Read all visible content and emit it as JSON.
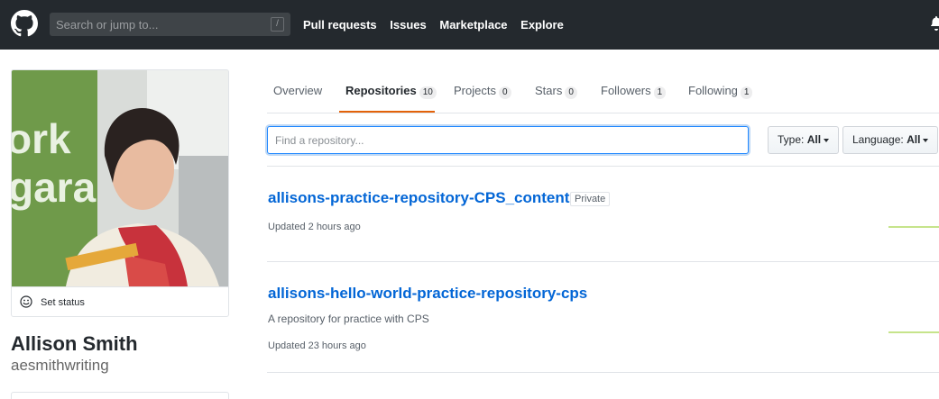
{
  "header": {
    "search_placeholder": "Search or jump to...",
    "slash_key": "/",
    "nav": [
      "Pull requests",
      "Issues",
      "Marketplace",
      "Explore"
    ]
  },
  "profile": {
    "set_status": "Set status",
    "full_name": "Allison Smith",
    "username": "aesmithwriting"
  },
  "tabs": [
    {
      "label": "Overview",
      "count": null
    },
    {
      "label": "Repositories",
      "count": "10"
    },
    {
      "label": "Projects",
      "count": "0"
    },
    {
      "label": "Stars",
      "count": "0"
    },
    {
      "label": "Followers",
      "count": "1"
    },
    {
      "label": "Following",
      "count": "1"
    }
  ],
  "filter": {
    "placeholder": "Find a repository...",
    "type_label": "Type:",
    "type_value": "All",
    "language_label": "Language:",
    "language_value": "All"
  },
  "repos": [
    {
      "name": "allisons-practice-repository-CPS_content",
      "badge": "Private",
      "description": "",
      "updated": "Updated 2 hours ago"
    },
    {
      "name": "allisons-hello-world-practice-repository-cps",
      "badge": "",
      "description": "A repository for practice with CPS",
      "updated": "Updated 23 hours ago"
    }
  ],
  "colors": {
    "header_bg": "#24292e",
    "link": "#0366d6",
    "tab_accent": "#e36209"
  }
}
